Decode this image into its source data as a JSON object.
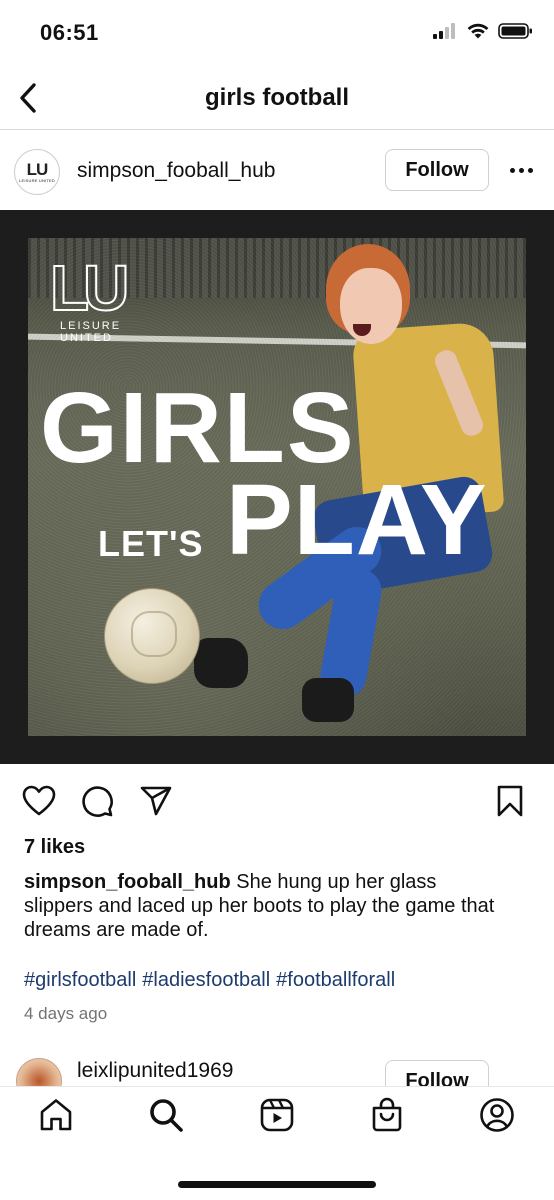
{
  "status_bar": {
    "time": "06:51",
    "icons": [
      "cellular-signal-icon",
      "wifi-icon",
      "battery-icon"
    ]
  },
  "header": {
    "title": "girls football",
    "back_icon": "chevron-left-icon"
  },
  "post": {
    "avatar_text": "LU",
    "avatar_subtext": "LEISURE UNITED",
    "username": "simpson_fooball_hub",
    "follow_label": "Follow",
    "more_icon": "more-horizontal-icon",
    "image": {
      "logo_letters": "LU",
      "logo_line1": "LEISURE",
      "logo_line2": "UNITED",
      "headline1": "GIRLS",
      "headline2_small": "LET'S",
      "headline2_big": "PLAY"
    },
    "likes": "7 likes",
    "caption_user": "simpson_fooball_hub",
    "caption_text": "She hung up her glass slippers and laced up her boots to play the game that dreams are made of.",
    "hashtags": [
      "#girlsfootball",
      "#ladiesfootball",
      "#footballforall"
    ],
    "timestamp": "4 days ago"
  },
  "actions": {
    "icons": [
      "heart-icon",
      "comment-icon",
      "share-icon",
      "bookmark-icon"
    ]
  },
  "next_post": {
    "username": "leixlipunited1969",
    "follow_label": "Follow"
  },
  "tab_bar": {
    "icons": [
      "home-icon",
      "search-icon",
      "reels-icon",
      "shop-icon",
      "profile-icon"
    ]
  },
  "colors": {
    "hashtag": "#1d3b6e",
    "timestamp": "#737373",
    "divider": "#dbdbdb"
  }
}
